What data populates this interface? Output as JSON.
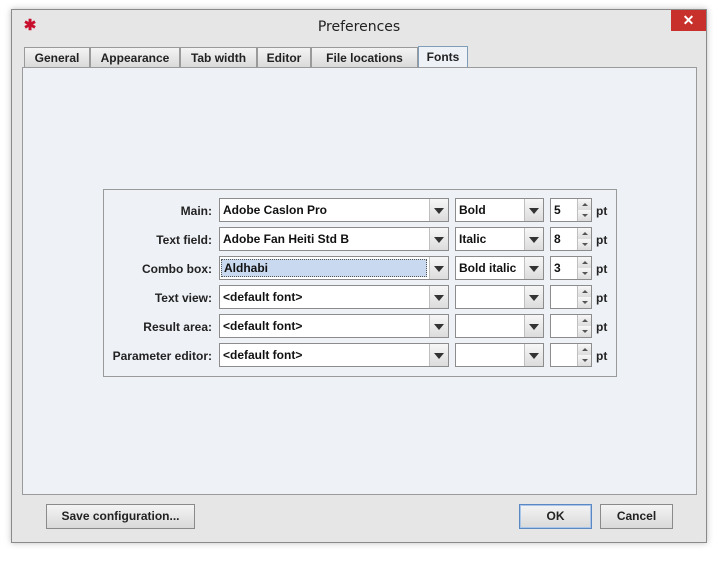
{
  "window": {
    "title": "Preferences",
    "close_glyph": "✕",
    "app_icon_glyph": "✱"
  },
  "tabs": [
    {
      "label": "General"
    },
    {
      "label": "Appearance"
    },
    {
      "label": "Tab width"
    },
    {
      "label": "Editor"
    },
    {
      "label": "File locations"
    },
    {
      "label": "Fonts",
      "active": true
    }
  ],
  "fonts": {
    "unit": "pt",
    "rows": [
      {
        "label": "Main:",
        "font": "Adobe Caslon Pro",
        "style": "Bold",
        "size": "5"
      },
      {
        "label": "Text field:",
        "font": "Adobe Fan Heiti Std B",
        "style": "Italic",
        "size": "8"
      },
      {
        "label": "Combo box:",
        "font": "Aldhabi",
        "style": "Bold italic",
        "size": "3"
      },
      {
        "label": "Text view:",
        "font": "<default font>",
        "style": "",
        "size": ""
      },
      {
        "label": "Result area:",
        "font": "<default font>",
        "style": "",
        "size": ""
      },
      {
        "label": "Parameter editor:",
        "font": "<default font>",
        "style": "",
        "size": ""
      }
    ]
  },
  "buttons": {
    "save": "Save configuration...",
    "ok": "OK",
    "cancel": "Cancel"
  }
}
